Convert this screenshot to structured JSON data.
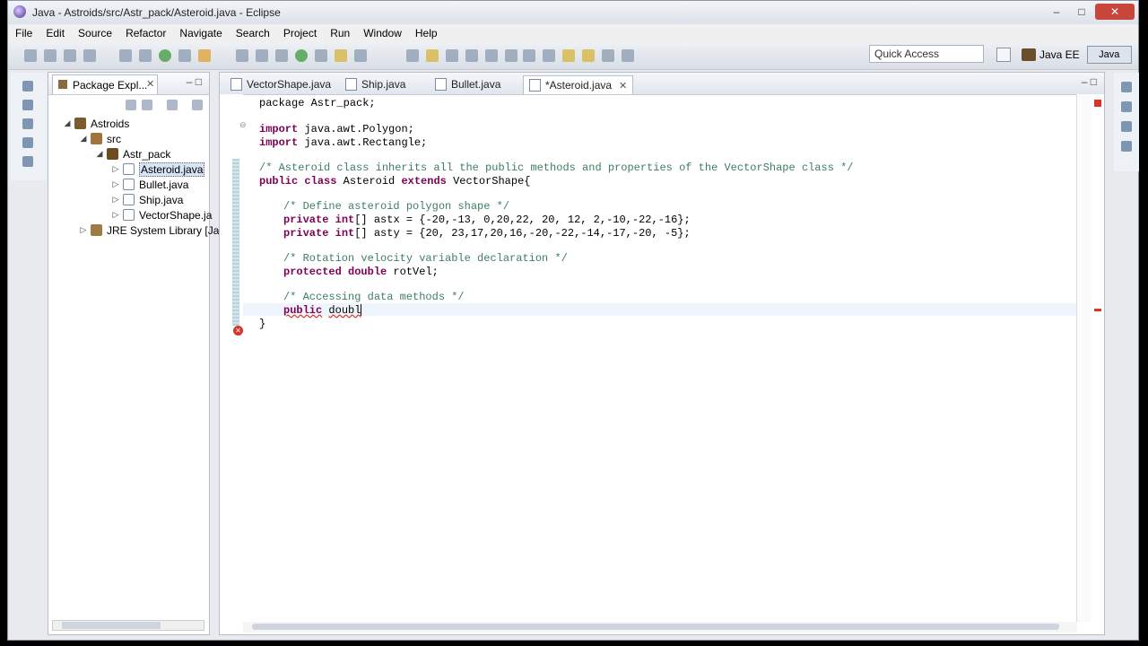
{
  "window": {
    "title": "Java - Astroids/src/Astr_pack/Asteroid.java - Eclipse",
    "buttons": {
      "minimize": "–",
      "maximize": "□",
      "close": "✕"
    }
  },
  "menu": [
    "File",
    "Edit",
    "Source",
    "Refactor",
    "Navigate",
    "Search",
    "Project",
    "Run",
    "Window",
    "Help"
  ],
  "toolbar": {
    "quick_access_placeholder": "Quick Access",
    "perspective_label": "Java EE",
    "perspective_java": "Java"
  },
  "package_explorer": {
    "tab_label": "Package Expl...",
    "close_glyph": "✕",
    "view_controls": "– □",
    "tree": {
      "project": "Astroids",
      "src": "src",
      "package": "Astr_pack",
      "files": [
        "Asteroid.java",
        "Bullet.java",
        "Ship.java",
        "VectorShape.ja"
      ],
      "library": "JRE System Library [Ja"
    }
  },
  "editor": {
    "tabs": [
      "VectorShape.java",
      "Ship.java",
      "Bullet.java",
      "*Asteroid.java"
    ],
    "close_glyph": "✕",
    "view_controls": "– □",
    "code": {
      "l1": "package Astr_pack;",
      "l2_kw": "import",
      "l2_rest": " java.awt.Polygon;",
      "l3_kw": "import",
      "l3_rest": " java.awt.Rectangle;",
      "l4": "/* Asteroid class inherits all the public methods and properties of the VectorShape class */",
      "l5_kw1": "public",
      "l5_kw2": "class",
      "l5_mid": " Asteroid ",
      "l5_kw3": "extends",
      "l5_rest": " VectorShape{",
      "l6": "/* Define asteroid polygon shape */",
      "l7_kw1": "private",
      "l7_kw2": "int",
      "l7_rest": "[] astx = {-20,-13, 0,20,22, 20, 12, 2,-10,-22,-16};",
      "l8_kw1": "private",
      "l8_kw2": "int",
      "l8_rest": "[] asty = {20, 23,17,20,16,-20,-22,-14,-17,-20, -5};",
      "l9": "/* Rotation velocity variable declaration */",
      "l10_kw1": "protected",
      "l10_kw2": "double",
      "l10_rest": " rotVel;",
      "l11": "/* Accessing data methods */",
      "l12_kw": "public",
      "l12_rest": "doubl",
      "l13": "}"
    }
  }
}
